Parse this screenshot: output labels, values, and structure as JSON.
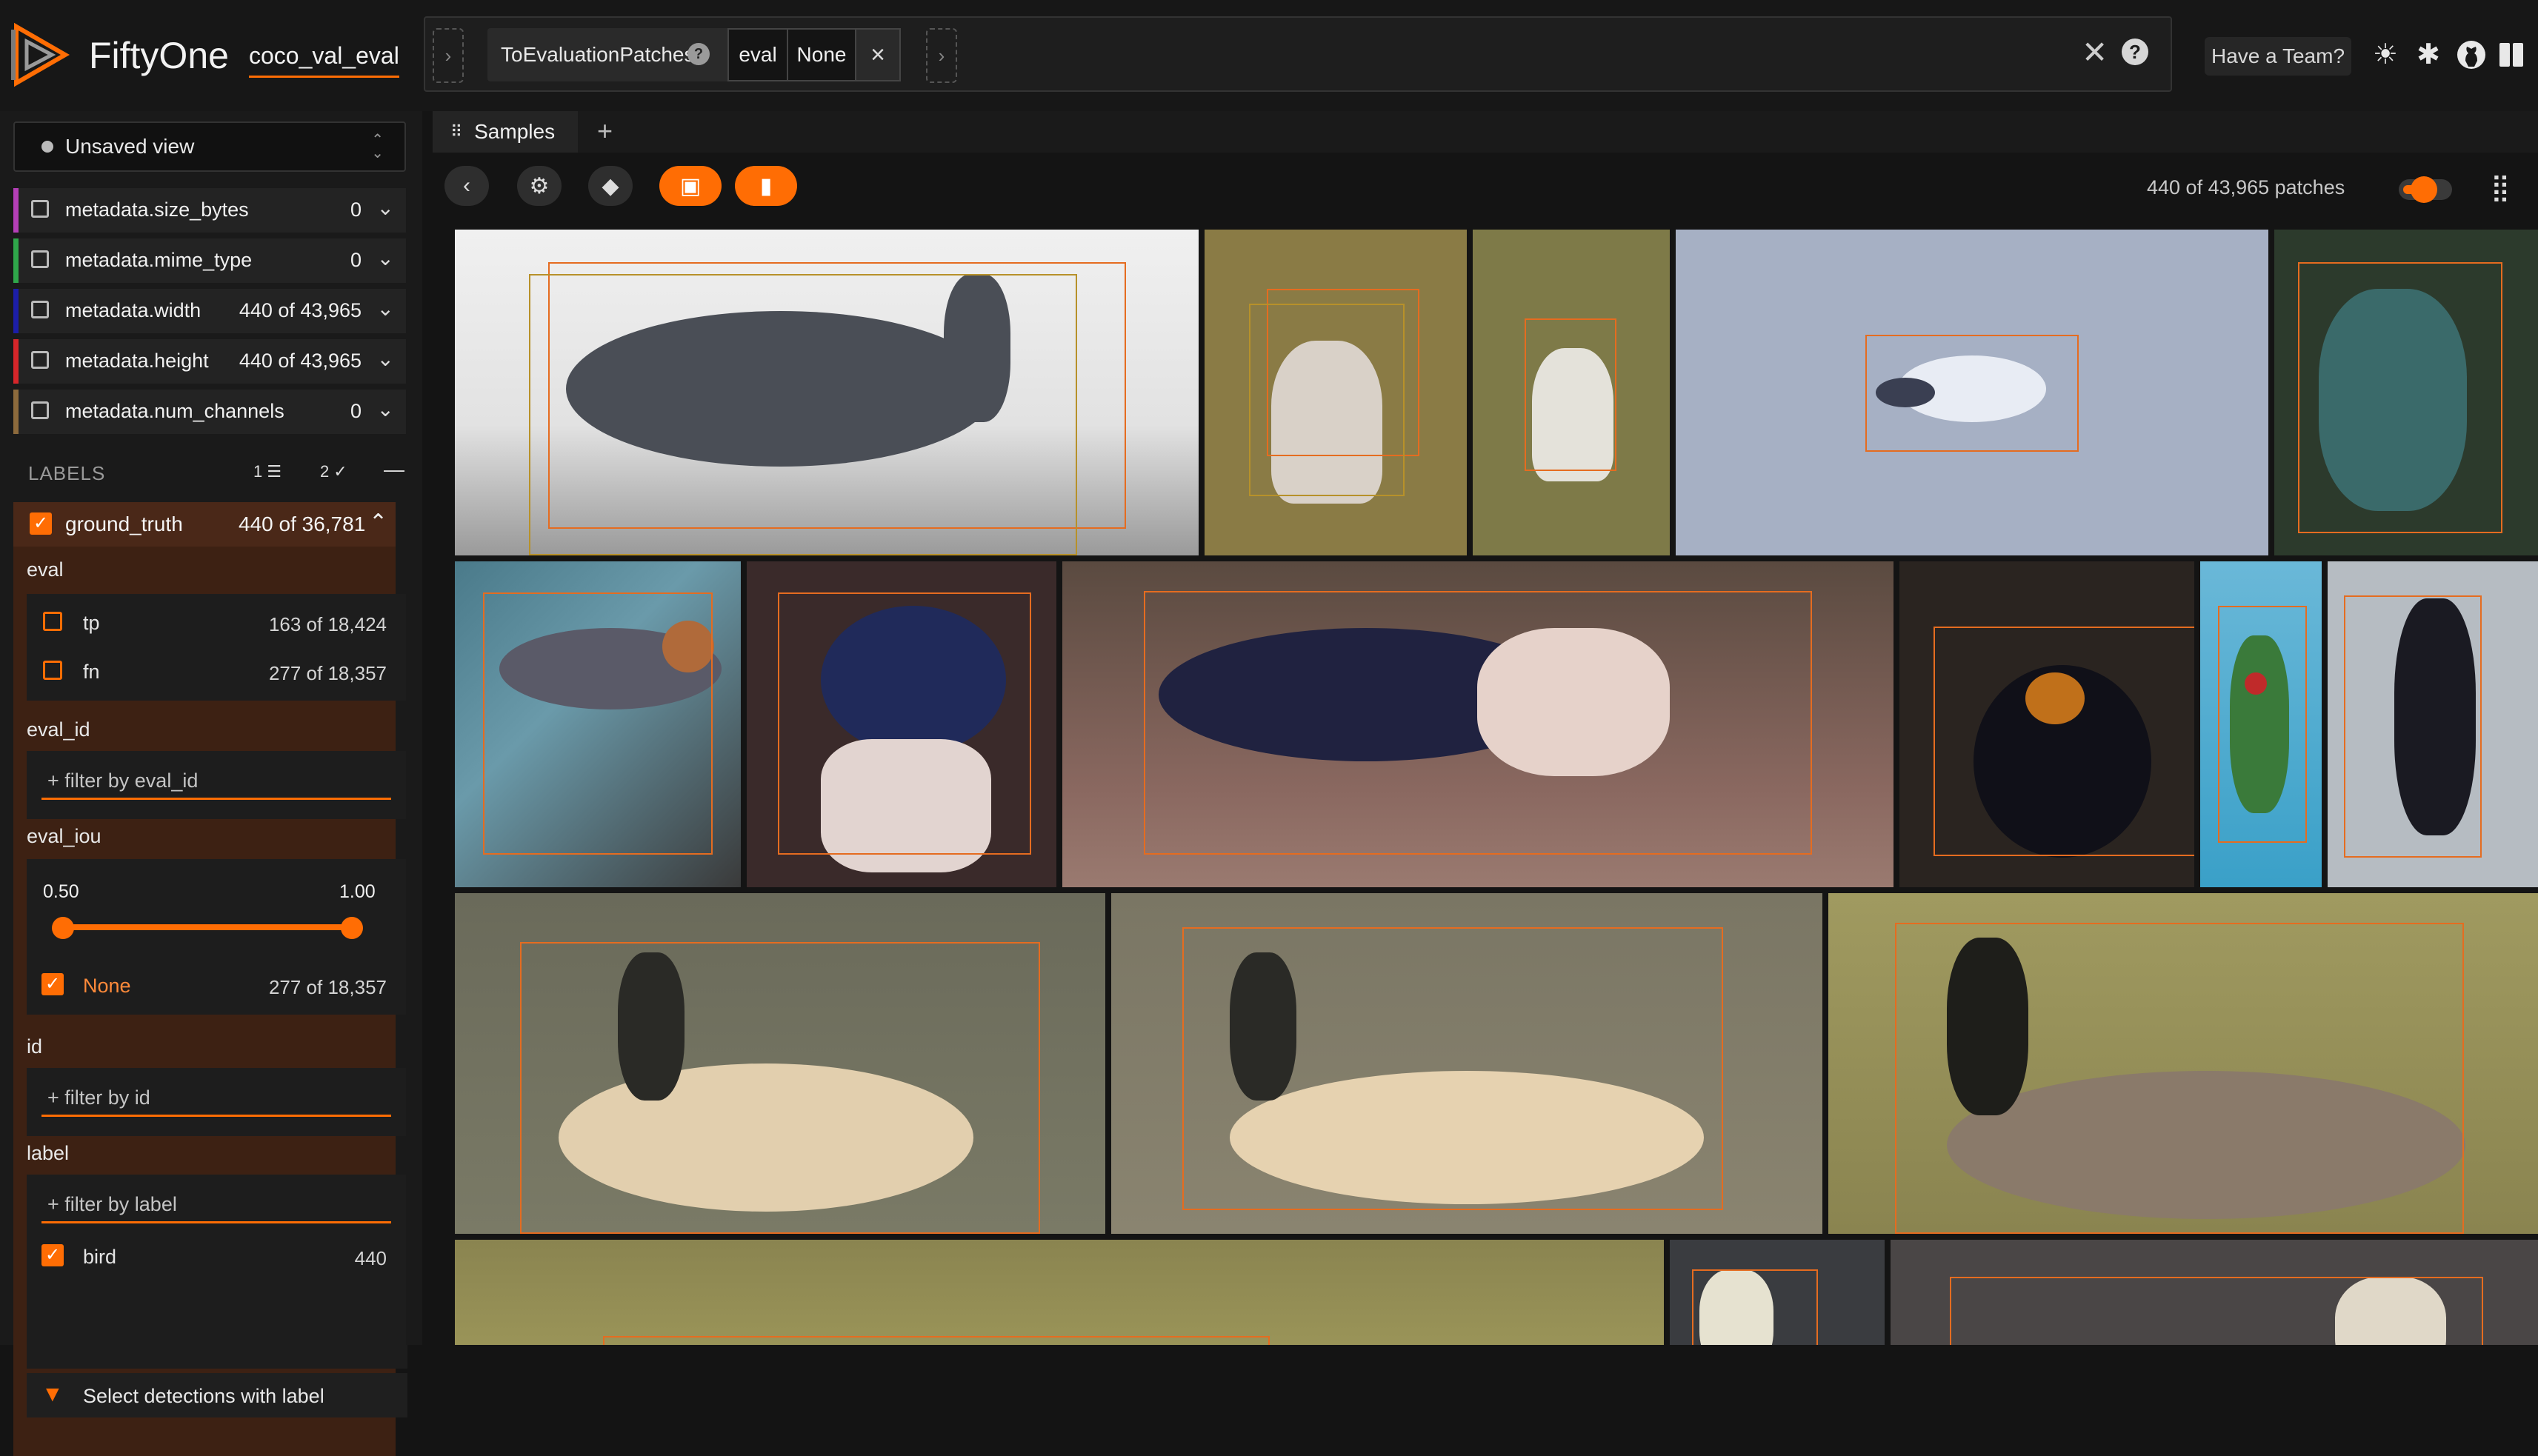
{
  "header": {
    "app_name": "FiftyOne",
    "dataset": "coco_val_eval",
    "stage": {
      "name": "ToEvaluationPatches",
      "params": [
        "eval",
        "None"
      ]
    },
    "team_button": "Have a Team?",
    "icons": [
      "logo",
      "close-icon",
      "help-icon",
      "theme-icon",
      "slack-icon",
      "github-icon",
      "book-icon"
    ]
  },
  "sidebar": {
    "view_selector": "Unsaved view",
    "fields": [
      {
        "name": "metadata.size_bytes",
        "count": "0",
        "color": "#b43fb7"
      },
      {
        "name": "metadata.mime_type",
        "count": "0",
        "color": "#2fa64a"
      },
      {
        "name": "metadata.width",
        "count": "440 of 43,965",
        "color": "#1c1ea8"
      },
      {
        "name": "metadata.height",
        "count": "440 of 43,965",
        "color": "#d6262a"
      },
      {
        "name": "metadata.num_channels",
        "count": "0",
        "color": "#8c6a3c"
      }
    ],
    "labels": {
      "title": "LABELS",
      "filter_count": "1",
      "visible_count": "2"
    },
    "ground_truth": {
      "name": "ground_truth",
      "count": "440 of 36,781",
      "eval": {
        "label": "eval",
        "options": [
          {
            "name": "tp",
            "count": "163 of 18,424"
          },
          {
            "name": "fn",
            "count": "277 of 18,357"
          }
        ]
      },
      "eval_id": {
        "label": "eval_id",
        "placeholder": "+ filter by eval_id"
      },
      "eval_iou": {
        "label": "eval_iou",
        "min": "0.50",
        "max": "1.00",
        "none_label": "None",
        "none_count": "277 of 18,357"
      },
      "id": {
        "label": "id",
        "placeholder": "+ filter by id"
      },
      "label": {
        "label": "label",
        "placeholder": "+ filter by label",
        "value_name": "bird",
        "value_count": "440"
      },
      "select_detections": "Select detections with label"
    }
  },
  "main": {
    "tab": "Samples",
    "patch_count": "440 of 43,965 patches",
    "accent_color": "#ff6d04"
  }
}
